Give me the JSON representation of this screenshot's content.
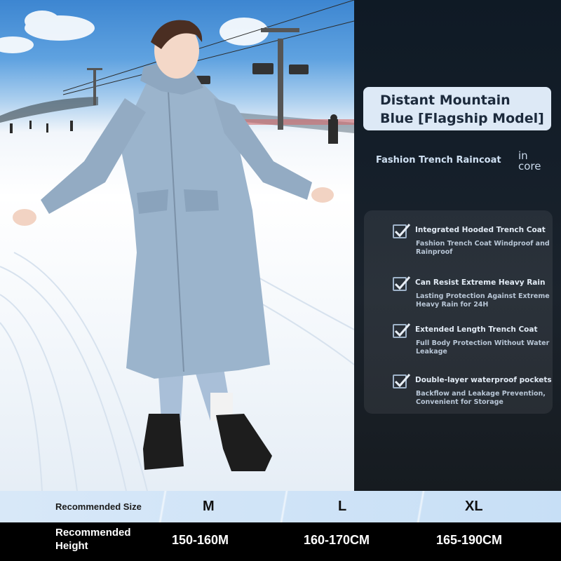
{
  "colors": {
    "panel_bg": "#141e29",
    "title_box_bg": "#dde9f6",
    "title_text": "#1c2a3c",
    "coat_blue": "#9bb4cc",
    "size_row_bg": "#d0e4f7",
    "height_row_bg": "#000000"
  },
  "product": {
    "title_line1": "Distant Mountain",
    "title_line2": "Blue [Flagship Model]",
    "subtitle": "Fashion Trench Raincoat",
    "brand_line1": "in",
    "brand_line2": "core"
  },
  "features": [
    {
      "icon": "checkbox-checked-icon",
      "title": "Integrated Hooded Trench Coat",
      "desc": "Fashion Trench Coat Windproof and Rainproof"
    },
    {
      "icon": "checkbox-checked-icon",
      "title": "Can Resist Extreme Heavy Rain",
      "desc": "Lasting Protection Against Extreme Heavy Rain for 24H"
    },
    {
      "icon": "checkbox-checked-icon",
      "title": "Extended Length Trench Coat",
      "desc": "Full Body Protection Without Water Leakage"
    },
    {
      "icon": "checkbox-checked-icon",
      "title": "Double-layer waterproof pockets",
      "desc": "Backflow and Leakage Prevention, Convenient for Storage"
    }
  ],
  "size_table": {
    "size_label": "Recommended Size",
    "height_label_line1": "Recommended",
    "height_label_line2": "Height",
    "sizes": [
      "M",
      "L",
      "XL"
    ],
    "heights": [
      "150-160M",
      "160-170CM",
      "165-190CM"
    ]
  }
}
